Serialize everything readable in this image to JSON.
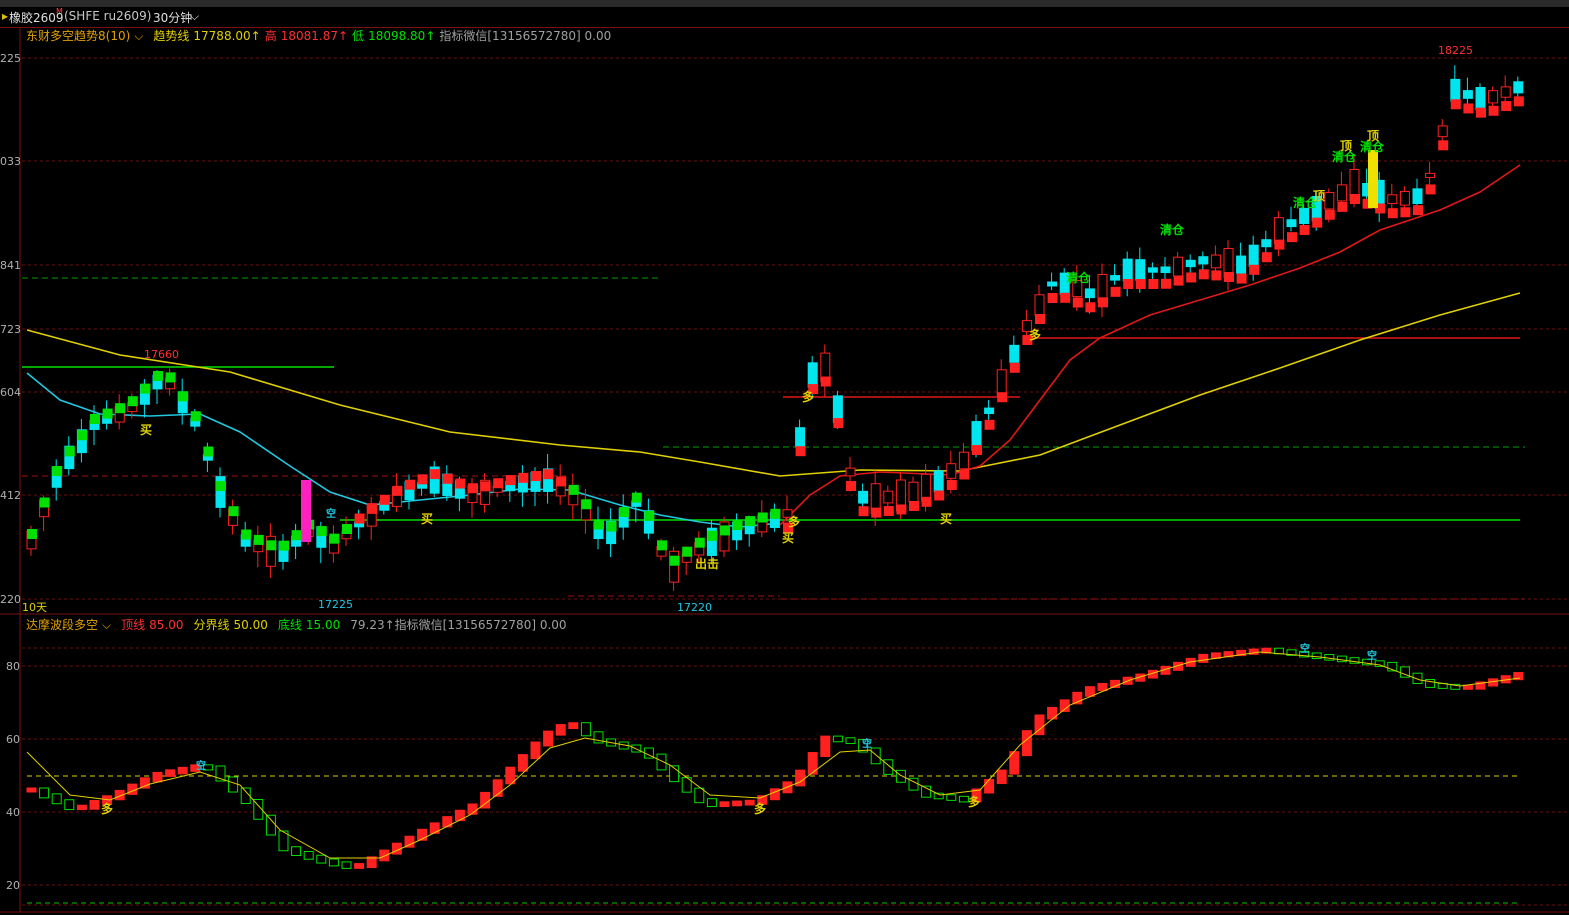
{
  "title_bar": {
    "symbol_name": "橡胶2609",
    "superscript": "M",
    "code": "(SHFE ru2609)",
    "period": "30分钟",
    "chevron": "chevron-down-icon"
  },
  "main_header": {
    "indicator": "东财多空趋势8(10)",
    "trend_label": "趋势线",
    "trend_value": "17788.00↑",
    "high_label": "高",
    "high_value": "18081.87↑",
    "low_label": "低",
    "low_value": "18098.80↑",
    "wechat": "指标微信[13156572780] 0.00"
  },
  "sub_header": {
    "indicator": "达摩波段多空",
    "top_label": "顶线",
    "top_value": "85.00",
    "mid_label": "分界线",
    "mid_value": "50.00",
    "bottom_label": "底线",
    "bottom_value": "15.00",
    "extra": "79.23↑指标微信[13156572780] 0.00"
  },
  "main_axis": [
    "225",
    "033",
    "841",
    "723",
    "604",
    "412",
    "220"
  ],
  "sub_axis": [
    "80",
    "60",
    "40",
    "20"
  ],
  "annotations": {
    "high_mark": "18225",
    "peak_mark": "17660",
    "low_mark_1": "17225",
    "low_mark_2": "17220",
    "period_note": "10天"
  },
  "signals": {
    "buy": "买",
    "long": "多",
    "short": "空",
    "clear": "清仓",
    "top": "顶",
    "strike": "出击"
  },
  "colors": {
    "up": "#ff2020",
    "down_fill": "#00e5ee",
    "green": "#00e000",
    "yellow_line": "#e0d000",
    "red_line": "#e01818",
    "cyan_line": "#20c8e0",
    "grid": "#6a1010"
  },
  "chart_data": {
    "type": "candlestick",
    "ylim": [
      17220,
      18225
    ],
    "sub_ylim": [
      15,
      85
    ],
    "series": [
      {
        "name": "趋势线",
        "values": []
      }
    ]
  }
}
